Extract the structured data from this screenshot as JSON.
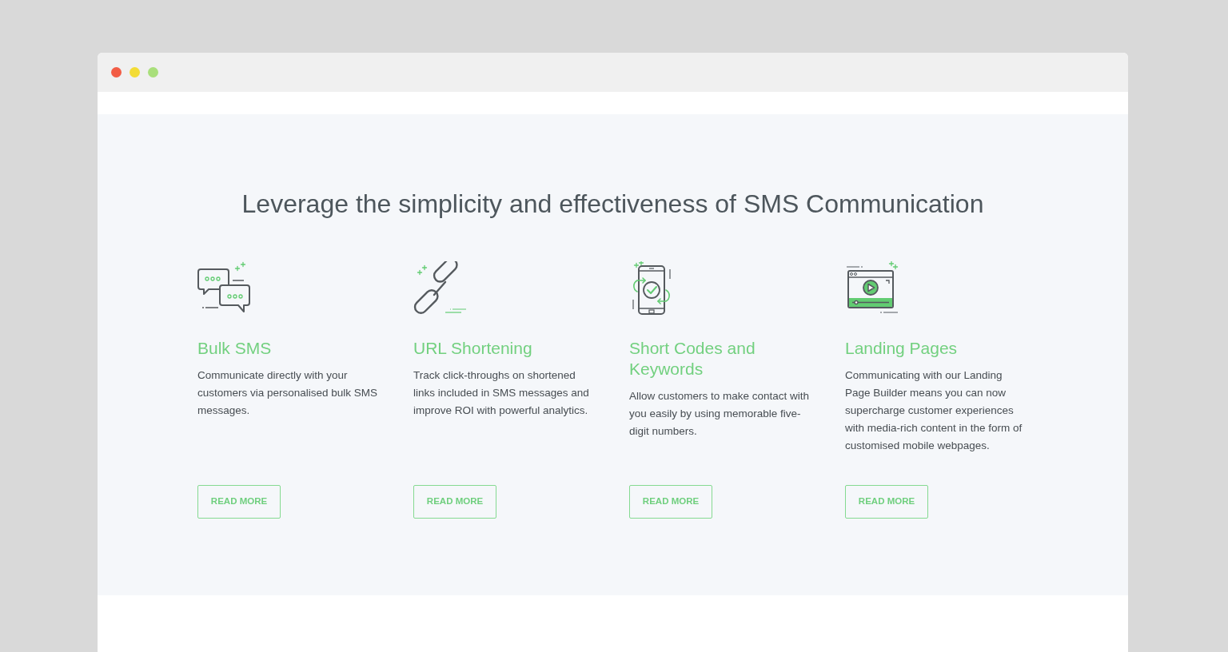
{
  "window": {
    "controls": [
      {
        "color": "#f25c45"
      },
      {
        "color": "#f3dc35"
      },
      {
        "color": "#a9df7b"
      }
    ]
  },
  "heading": "Leverage the simplicity and effectiveness of SMS Communication",
  "features": [
    {
      "kind": "chat",
      "title": "Bulk SMS",
      "description": "Communicate directly with your customers via personalised bulk SMS messages.",
      "button": "READ MORE"
    },
    {
      "kind": "link",
      "title": "URL Shortening",
      "description": "Track click-throughs on shortened links included in SMS messages and improve ROI with powerful analytics.",
      "button": "READ MORE"
    },
    {
      "kind": "phone",
      "title": "Short Codes and Keywords",
      "description": "Allow customers to make contact with you easily by using memorable five-digit numbers.",
      "button": "READ MORE"
    },
    {
      "kind": "video",
      "title": "Landing Pages",
      "description": "Communicating with our Landing Page Builder means you can now supercharge customer experiences with media-rich content in the form of customised mobile webpages.",
      "button": "READ MORE"
    }
  ]
}
